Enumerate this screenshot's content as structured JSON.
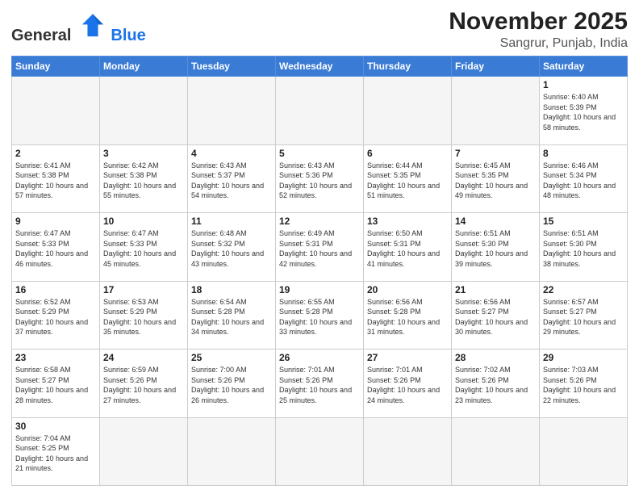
{
  "logo": {
    "text_general": "General",
    "text_blue": "Blue"
  },
  "header": {
    "month_title": "November 2025",
    "location": "Sangrur, Punjab, India"
  },
  "weekdays": [
    "Sunday",
    "Monday",
    "Tuesday",
    "Wednesday",
    "Thursday",
    "Friday",
    "Saturday"
  ],
  "days": {
    "d1": {
      "num": "1",
      "sunrise": "6:40 AM",
      "sunset": "5:39 PM",
      "daylight": "10 hours and 58 minutes."
    },
    "d2": {
      "num": "2",
      "sunrise": "6:41 AM",
      "sunset": "5:38 PM",
      "daylight": "10 hours and 57 minutes."
    },
    "d3": {
      "num": "3",
      "sunrise": "6:42 AM",
      "sunset": "5:38 PM",
      "daylight": "10 hours and 55 minutes."
    },
    "d4": {
      "num": "4",
      "sunrise": "6:43 AM",
      "sunset": "5:37 PM",
      "daylight": "10 hours and 54 minutes."
    },
    "d5": {
      "num": "5",
      "sunrise": "6:43 AM",
      "sunset": "5:36 PM",
      "daylight": "10 hours and 52 minutes."
    },
    "d6": {
      "num": "6",
      "sunrise": "6:44 AM",
      "sunset": "5:35 PM",
      "daylight": "10 hours and 51 minutes."
    },
    "d7": {
      "num": "7",
      "sunrise": "6:45 AM",
      "sunset": "5:35 PM",
      "daylight": "10 hours and 49 minutes."
    },
    "d8": {
      "num": "8",
      "sunrise": "6:46 AM",
      "sunset": "5:34 PM",
      "daylight": "10 hours and 48 minutes."
    },
    "d9": {
      "num": "9",
      "sunrise": "6:47 AM",
      "sunset": "5:33 PM",
      "daylight": "10 hours and 46 minutes."
    },
    "d10": {
      "num": "10",
      "sunrise": "6:47 AM",
      "sunset": "5:33 PM",
      "daylight": "10 hours and 45 minutes."
    },
    "d11": {
      "num": "11",
      "sunrise": "6:48 AM",
      "sunset": "5:32 PM",
      "daylight": "10 hours and 43 minutes."
    },
    "d12": {
      "num": "12",
      "sunrise": "6:49 AM",
      "sunset": "5:31 PM",
      "daylight": "10 hours and 42 minutes."
    },
    "d13": {
      "num": "13",
      "sunrise": "6:50 AM",
      "sunset": "5:31 PM",
      "daylight": "10 hours and 41 minutes."
    },
    "d14": {
      "num": "14",
      "sunrise": "6:51 AM",
      "sunset": "5:30 PM",
      "daylight": "10 hours and 39 minutes."
    },
    "d15": {
      "num": "15",
      "sunrise": "6:51 AM",
      "sunset": "5:30 PM",
      "daylight": "10 hours and 38 minutes."
    },
    "d16": {
      "num": "16",
      "sunrise": "6:52 AM",
      "sunset": "5:29 PM",
      "daylight": "10 hours and 37 minutes."
    },
    "d17": {
      "num": "17",
      "sunrise": "6:53 AM",
      "sunset": "5:29 PM",
      "daylight": "10 hours and 35 minutes."
    },
    "d18": {
      "num": "18",
      "sunrise": "6:54 AM",
      "sunset": "5:28 PM",
      "daylight": "10 hours and 34 minutes."
    },
    "d19": {
      "num": "19",
      "sunrise": "6:55 AM",
      "sunset": "5:28 PM",
      "daylight": "10 hours and 33 minutes."
    },
    "d20": {
      "num": "20",
      "sunrise": "6:56 AM",
      "sunset": "5:28 PM",
      "daylight": "10 hours and 31 minutes."
    },
    "d21": {
      "num": "21",
      "sunrise": "6:56 AM",
      "sunset": "5:27 PM",
      "daylight": "10 hours and 30 minutes."
    },
    "d22": {
      "num": "22",
      "sunrise": "6:57 AM",
      "sunset": "5:27 PM",
      "daylight": "10 hours and 29 minutes."
    },
    "d23": {
      "num": "23",
      "sunrise": "6:58 AM",
      "sunset": "5:27 PM",
      "daylight": "10 hours and 28 minutes."
    },
    "d24": {
      "num": "24",
      "sunrise": "6:59 AM",
      "sunset": "5:26 PM",
      "daylight": "10 hours and 27 minutes."
    },
    "d25": {
      "num": "25",
      "sunrise": "7:00 AM",
      "sunset": "5:26 PM",
      "daylight": "10 hours and 26 minutes."
    },
    "d26": {
      "num": "26",
      "sunrise": "7:01 AM",
      "sunset": "5:26 PM",
      "daylight": "10 hours and 25 minutes."
    },
    "d27": {
      "num": "27",
      "sunrise": "7:01 AM",
      "sunset": "5:26 PM",
      "daylight": "10 hours and 24 minutes."
    },
    "d28": {
      "num": "28",
      "sunrise": "7:02 AM",
      "sunset": "5:26 PM",
      "daylight": "10 hours and 23 minutes."
    },
    "d29": {
      "num": "29",
      "sunrise": "7:03 AM",
      "sunset": "5:26 PM",
      "daylight": "10 hours and 22 minutes."
    },
    "d30": {
      "num": "30",
      "sunrise": "7:04 AM",
      "sunset": "5:25 PM",
      "daylight": "10 hours and 21 minutes."
    }
  },
  "labels": {
    "sunrise": "Sunrise:",
    "sunset": "Sunset:",
    "daylight": "Daylight:"
  }
}
